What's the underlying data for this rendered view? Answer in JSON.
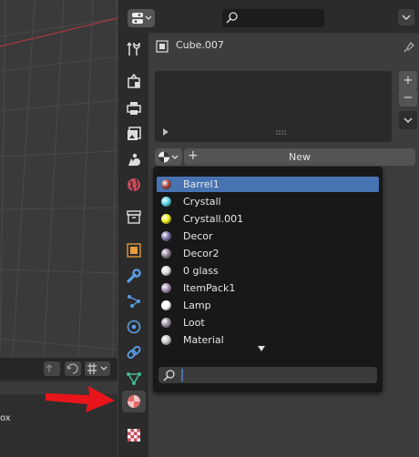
{
  "object": {
    "name": "Cube.007"
  },
  "material_slot": {
    "new_label": "New"
  },
  "materials": [
    {
      "name": "Barrel1",
      "selected": true,
      "color": "#a0463c"
    },
    {
      "name": "Crystall",
      "selected": false,
      "color": "#55d6ea"
    },
    {
      "name": "Crystall.001",
      "selected": false,
      "color": "#f0ee1a"
    },
    {
      "name": "Decor",
      "selected": false,
      "color": "#7a6fa6"
    },
    {
      "name": "Decor2",
      "selected": false,
      "color": "#8a7f94"
    },
    {
      "name": "0 glass",
      "selected": false,
      "color": "#dcdcdc"
    },
    {
      "name": "ItemPack1",
      "selected": false,
      "color": "#a28db0"
    },
    {
      "name": "Lamp",
      "selected": false,
      "color": "#ffffff"
    },
    {
      "name": "Loot",
      "selected": false,
      "color": "#9a8ea0"
    },
    {
      "name": "Material",
      "selected": false,
      "color": "#c9c9c9"
    }
  ],
  "bottom_left": {
    "partial_text": "ox"
  },
  "colors": {
    "selection": "#4773b3",
    "annotation_arrow": "#e8151a",
    "active_tab": "#e06a6a"
  },
  "tabs": [
    "tool-icon",
    "render-icon",
    "output-icon",
    "view-layer-icon",
    "scene-icon",
    "world-icon",
    "collection-icon",
    "object-icon",
    "modifier-icon",
    "particles-icon",
    "physics-icon",
    "constraints-icon",
    "data-icon",
    "material-icon",
    "texture-icon"
  ]
}
